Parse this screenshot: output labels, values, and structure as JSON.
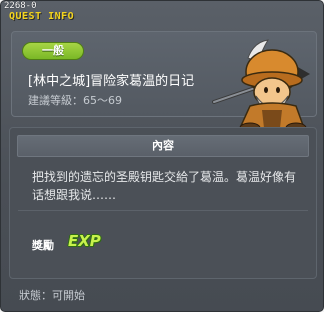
{
  "debug_id": "2268-0",
  "window": {
    "title": "QUEST INFO"
  },
  "quest": {
    "category": "一般",
    "title": "[林中之城]冒险家葛温的日记",
    "level": "建議等級：65～69",
    "npc_icon": "npc-gwin-portrait-icon"
  },
  "content": {
    "header": "內容",
    "text": "把找到的遗忘的圣殿钥匙交給了葛温。葛温好像有话想跟我说……"
  },
  "reward": {
    "label": "獎勵",
    "exp_text": "EXP",
    "exp_icon": "exp-icon"
  },
  "status": {
    "text": "狀態：可開始"
  },
  "colors": {
    "title": "#f3d41e",
    "badge": "#8cc633",
    "exp": "#c8f24c"
  }
}
